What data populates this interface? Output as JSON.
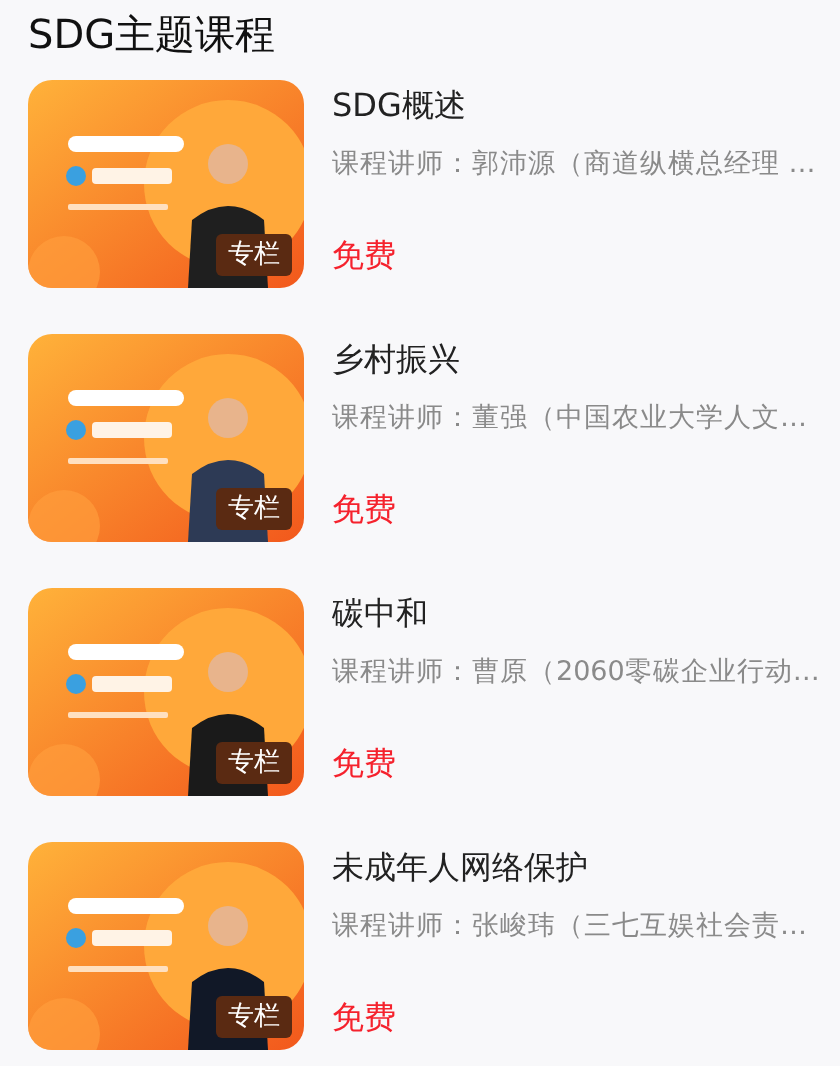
{
  "section_title": "SDG主题课程",
  "courses": [
    {
      "kind": "picture",
      "badge": "专栏",
      "title": "SDG概述",
      "lecturer": "课程讲师：郭沛源（商道纵横总经理 …",
      "price": "免费"
    },
    {
      "kind": "picture",
      "badge": "专栏",
      "title": "乡村振兴",
      "lecturer": "课程讲师：董强（中国农业大学人文…",
      "price": "免费"
    },
    {
      "kind": "picture",
      "badge": "专栏",
      "title": "碳中和",
      "lecturer": "课程讲师：曹原（2060零碳企业行动…",
      "price": "免费"
    },
    {
      "kind": "picture",
      "badge": "专栏",
      "title": "未成年人网络保护",
      "lecturer": "课程讲师：张峻玮（三七互娱社会责…",
      "price": "免费"
    }
  ]
}
